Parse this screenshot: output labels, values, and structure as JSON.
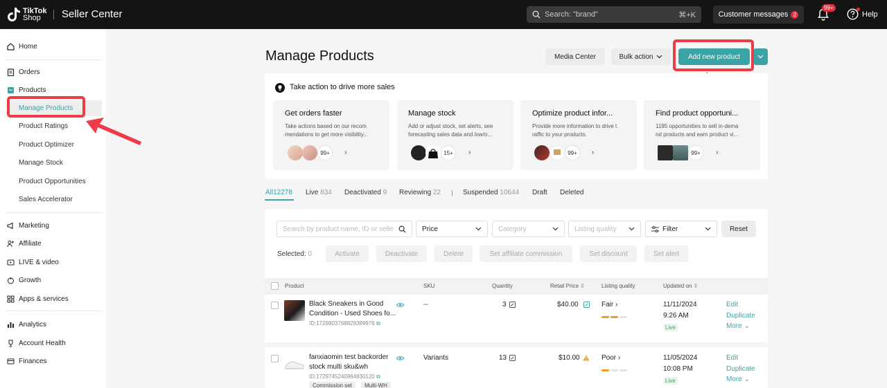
{
  "topbar": {
    "logo_text_line1": "TikTok",
    "logo_text_line2": "Shop",
    "app_title": "Seller Center",
    "search_placeholder": "Search: \"brand\"",
    "search_shortcut": "⌘+K",
    "customer_messages_label": "Customer messages",
    "customer_messages_count": "2",
    "notifications_count": "99+",
    "help_label": "Help"
  },
  "sidebar": {
    "home": "Home",
    "orders": "Orders",
    "products": "Products",
    "products_sub": [
      "Manage Products",
      "Product Ratings",
      "Product Optimizer",
      "Manage Stock",
      "Product Opportunities",
      "Sales Accelerator"
    ],
    "marketing": "Marketing",
    "affiliate": "Affiliate",
    "live_video": "LIVE & video",
    "growth": "Growth",
    "apps_services": "Apps & services",
    "analytics": "Analytics",
    "account_health": "Account Health",
    "finances": "Finances"
  },
  "header": {
    "page_title": "Manage Products",
    "media_center": "Media Center",
    "bulk_action": "Bulk action",
    "add_new_product": "Add new product"
  },
  "action_panel": {
    "title": "Take action to drive more sales",
    "cards": [
      {
        "title": "Get orders faster",
        "desc": "Take actions based on our recom mendations to get more visibility...",
        "count": "99+"
      },
      {
        "title": "Manage stock",
        "desc": "Add or adjust stock, set alerts, see forecasting sales data and low/o...",
        "count": "15+"
      },
      {
        "title": "Optimize product infor...",
        "desc": "Provide more information to drive t raffic to your products.",
        "count": "99+"
      },
      {
        "title": "Find product opportuni...",
        "desc": "1195 opportunities to sell in-dema nd products and earn product vi...",
        "count": "99+"
      }
    ]
  },
  "tabs": [
    {
      "label": "All",
      "count": "12278"
    },
    {
      "label": "Live",
      "count": "834"
    },
    {
      "label": "Deactivated",
      "count": "9"
    },
    {
      "label": "Reviewing",
      "count": "22"
    },
    {
      "label": "Suspended",
      "count": "10644"
    },
    {
      "label": "Draft",
      "count": ""
    },
    {
      "label": "Deleted",
      "count": ""
    }
  ],
  "filters": {
    "search_placeholder": "Search by product name, ID or seller SKU",
    "price": "Price",
    "category": "Category",
    "listing_quality": "Listing quality",
    "filter": "Filter",
    "reset": "Reset"
  },
  "bulk": {
    "selected_label": "Selected:",
    "selected_count": "0",
    "activate": "Activate",
    "deactivate": "Deactivate",
    "delete": "Delete",
    "set_affiliate_commission": "Set affiliate commission",
    "set_discount": "Set discount",
    "set_alert": "Set alert"
  },
  "table": {
    "columns": [
      "Product",
      "SKU",
      "Quantity",
      "Retail Price",
      "Listing quality",
      "Updated on"
    ],
    "rows": [
      {
        "name": "Black Sneakers in Good Condition - Used Shoes fo...",
        "id": "ID:1729903768829399976",
        "sku": "--",
        "quantity": "3",
        "price": "$40.00",
        "quality": "Fair",
        "date": "11/11/2024",
        "time": "9:26 AM",
        "status": "Live",
        "actions": [
          "Edit",
          "Duplicate",
          "More"
        ]
      },
      {
        "name": "fanxiaomin test backorder stock multi sku&wh",
        "id": "ID:1729745240964830120",
        "sku": "Variants",
        "quantity": "13",
        "price": "$10.00",
        "quality": "Poor",
        "date": "11/05/2024",
        "time": "10:08 PM",
        "status": "Live",
        "actions": [
          "Edit",
          "Duplicate",
          "More"
        ],
        "tags": [
          "Commission set",
          "Multi-WH"
        ]
      }
    ]
  },
  "colors": {
    "accent": "#3aa3a5",
    "highlight": "#ee3b48",
    "topbar": "#141414"
  }
}
